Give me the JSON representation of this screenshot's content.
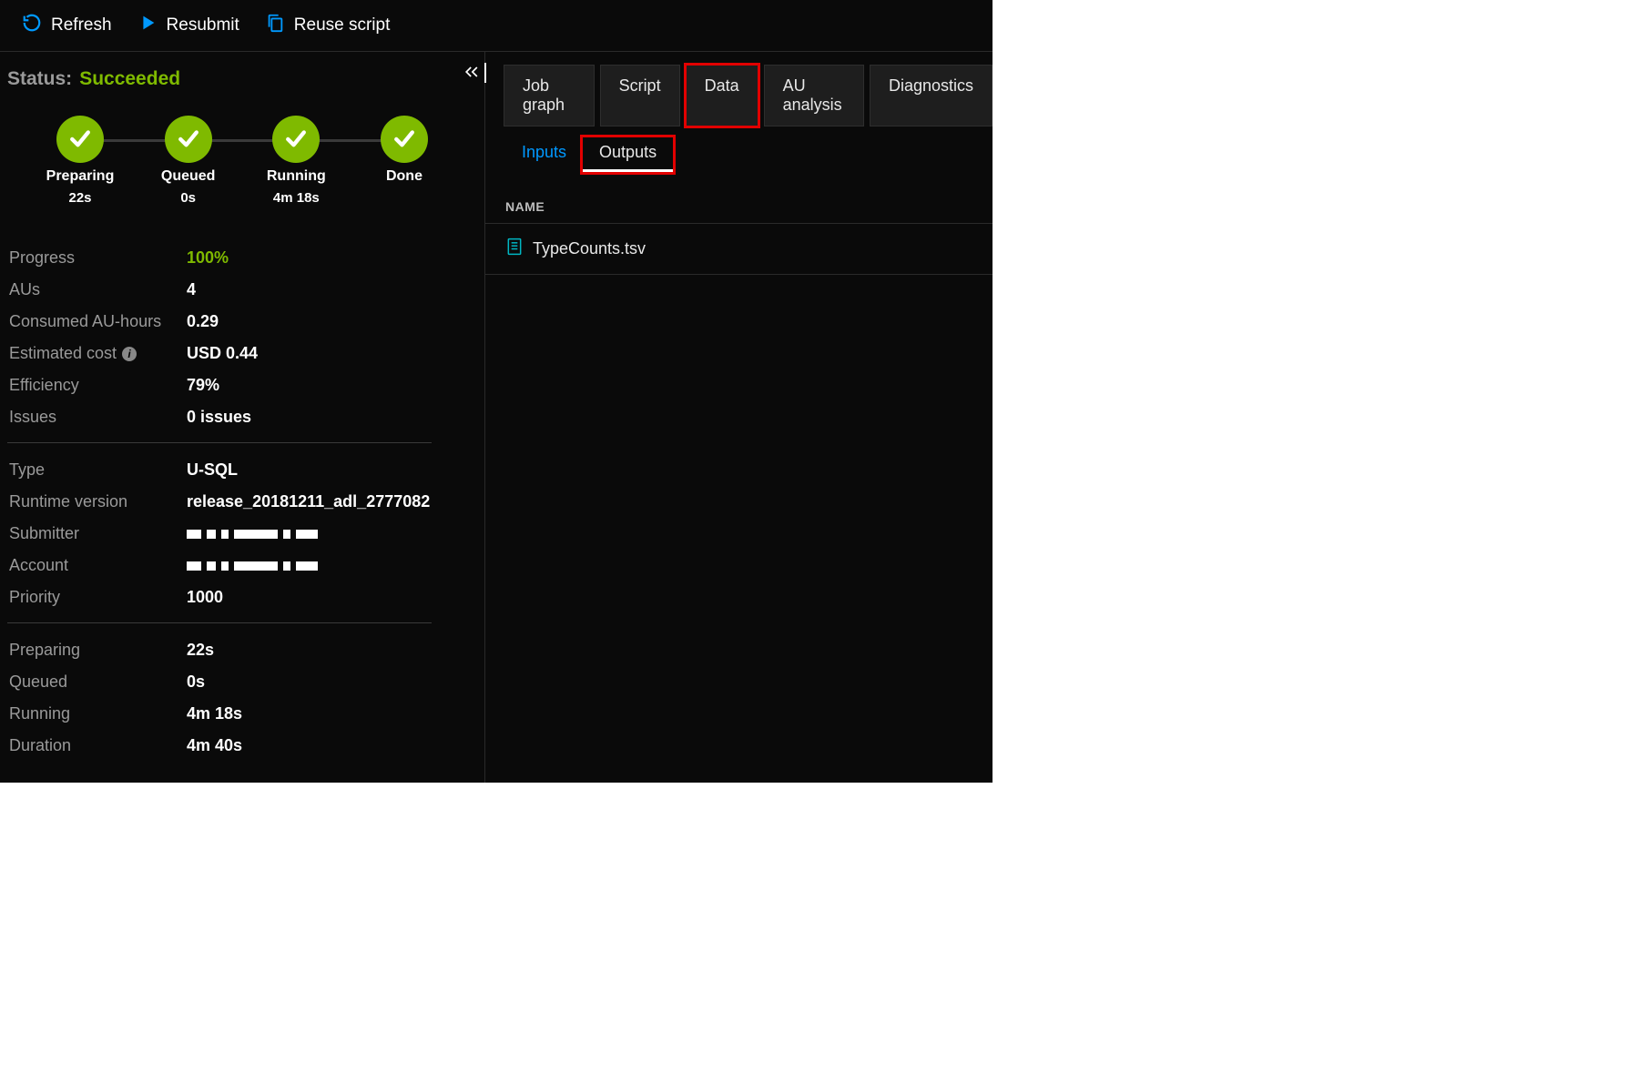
{
  "toolbar": {
    "refresh": "Refresh",
    "resubmit": "Resubmit",
    "reuse": "Reuse script"
  },
  "status": {
    "label": "Status:",
    "value": "Succeeded"
  },
  "stages": [
    {
      "name": "Preparing",
      "time": "22s"
    },
    {
      "name": "Queued",
      "time": "0s"
    },
    {
      "name": "Running",
      "time": "4m 18s"
    },
    {
      "name": "Done",
      "time": ""
    }
  ],
  "metrics1": [
    {
      "k": "Progress",
      "v": "100%",
      "green": true
    },
    {
      "k": "AUs",
      "v": "4"
    },
    {
      "k": "Consumed AU-hours",
      "v": "0.29"
    },
    {
      "k": "Estimated cost",
      "v": "USD 0.44",
      "info": true
    },
    {
      "k": "Efficiency",
      "v": "79%"
    },
    {
      "k": "Issues",
      "v": "0 issues"
    }
  ],
  "metrics2": [
    {
      "k": "Type",
      "v": "U-SQL"
    },
    {
      "k": "Runtime version",
      "v": "release_20181211_adl_2777082"
    },
    {
      "k": "Submitter",
      "v": "",
      "redacted": true
    },
    {
      "k": "Account",
      "v": "",
      "redacted": true
    },
    {
      "k": "Priority",
      "v": "1000"
    }
  ],
  "metrics3": [
    {
      "k": "Preparing",
      "v": "22s"
    },
    {
      "k": "Queued",
      "v": "0s"
    },
    {
      "k": "Running",
      "v": "4m 18s"
    },
    {
      "k": "Duration",
      "v": "4m 40s"
    }
  ],
  "tabs_primary": [
    {
      "label": "Job graph"
    },
    {
      "label": "Script"
    },
    {
      "label": "Data",
      "highlighted": true
    },
    {
      "label": "AU analysis"
    },
    {
      "label": "Diagnostics"
    }
  ],
  "tabs_secondary": [
    {
      "label": "Inputs",
      "active": true
    },
    {
      "label": "Outputs",
      "selected": true,
      "highlighted": true
    }
  ],
  "list_header": "NAME",
  "files": [
    {
      "name": "TypeCounts.tsv"
    }
  ]
}
